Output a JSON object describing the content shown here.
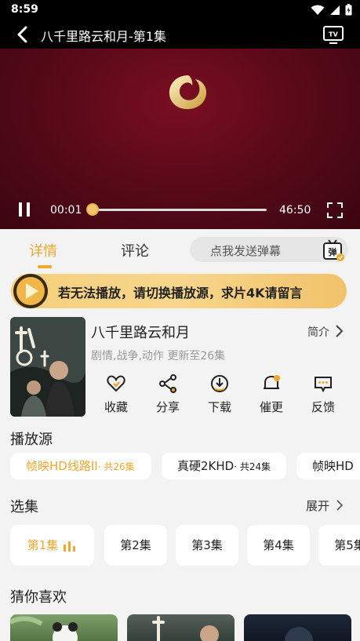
{
  "status_bar": {
    "time": "8:59"
  },
  "player": {
    "title": "八千里路云和月-第1集",
    "current_time": "00:01",
    "total_time": "46:50",
    "progress": 0.0004,
    "state": "playing"
  },
  "tabs": [
    {
      "label": "详情",
      "active": true
    },
    {
      "label": "评论",
      "active": false
    }
  ],
  "danmu": {
    "placeholder": "点我发送弹幕",
    "icon_text": "弹"
  },
  "notice_banner": {
    "text": "若无法播放，请切换播放源，求片4K请留言"
  },
  "show": {
    "title": "八千里路云和月",
    "intro_label": "简介",
    "meta": "剧情,战争,动作 更新至26集"
  },
  "actions": [
    {
      "label": "收藏",
      "icon": "heart-icon"
    },
    {
      "label": "分享",
      "icon": "share-icon"
    },
    {
      "label": "下载",
      "icon": "download-icon"
    },
    {
      "label": "催更",
      "icon": "notify-icon"
    },
    {
      "label": "反馈",
      "icon": "feedback-icon"
    }
  ],
  "sources": {
    "title": "播放源",
    "items": [
      {
        "name": "帧映HD线路II",
        "count": "· 共26集",
        "active": true
      },
      {
        "name": "真硬2KHD",
        "count": "· 共24集",
        "active": false
      },
      {
        "name": "帧映HD",
        "count": "",
        "active": false
      }
    ]
  },
  "episodes": {
    "title": "选集",
    "expand_label": "展开",
    "items": [
      {
        "label": "第1集",
        "active": true
      },
      {
        "label": "第2集",
        "active": false
      },
      {
        "label": "第3集",
        "active": false
      },
      {
        "label": "第4集",
        "active": false
      },
      {
        "label": "第5集",
        "active": false
      }
    ]
  },
  "recommend": {
    "title": "猜你喜欢"
  },
  "colors": {
    "accent": "#f0a830",
    "banner": "#f5cf7c",
    "player_bg": "#5a0a19"
  }
}
